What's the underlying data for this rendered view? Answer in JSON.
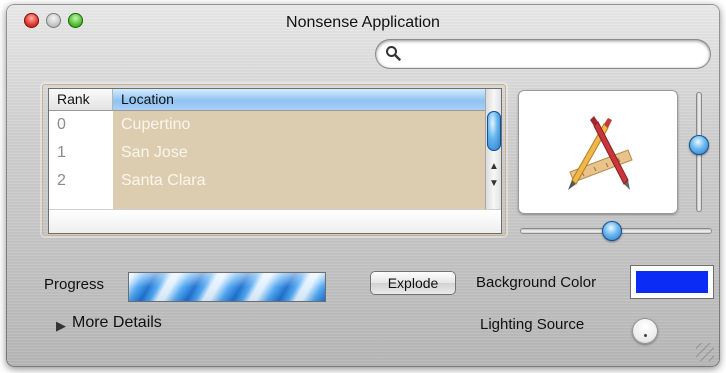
{
  "window": {
    "title": "Nonsense Application"
  },
  "search": {
    "placeholder": ""
  },
  "table": {
    "columns": [
      "Rank",
      "Location"
    ],
    "rows": [
      {
        "rank": "0",
        "location": "Cupertino"
      },
      {
        "rank": "1",
        "location": "San Jose"
      },
      {
        "rank": "2",
        "location": "Santa Clara"
      }
    ]
  },
  "controls": {
    "progress_label": "Progress",
    "explode_label": "Explode",
    "background_color_label": "Background Color",
    "background_color": "#0a2cf5",
    "more_details_label": "More Details",
    "lighting_source_label": "Lighting Source"
  },
  "icons": {
    "app_icon": "app-store-pencil-ruler-icon",
    "search_icon": "magnifier-icon"
  }
}
